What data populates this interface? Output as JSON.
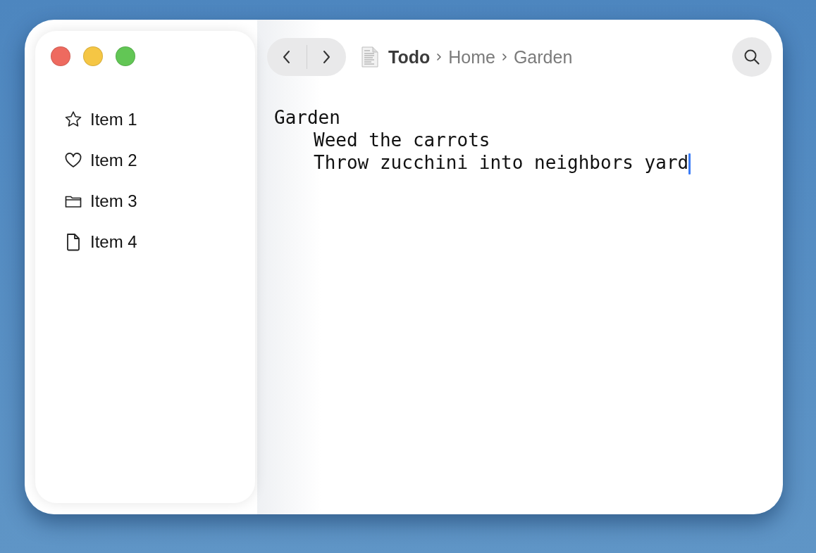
{
  "window": {
    "controls": [
      {
        "color": "#ee6a5f"
      },
      {
        "color": "#f5c644"
      },
      {
        "color": "#62c655"
      }
    ]
  },
  "sidebar": {
    "items": [
      {
        "label": "Item 1",
        "kind": "star"
      },
      {
        "label": "Item 2",
        "kind": "heart"
      },
      {
        "label": "Item 3",
        "kind": "folder"
      },
      {
        "label": "Item 4",
        "kind": "document"
      }
    ]
  },
  "toolbar": {
    "breadcrumb": [
      {
        "label": "Todo",
        "current": true
      },
      {
        "label": "Home",
        "current": false
      },
      {
        "label": "Garden",
        "current": false
      }
    ]
  },
  "outline": [
    {
      "text": "Garden",
      "caret": false,
      "children": [
        {
          "text": "Weed the carrots",
          "caret": false
        },
        {
          "text": "Throw zucchini into neighbors yard",
          "caret": true
        }
      ]
    }
  ]
}
